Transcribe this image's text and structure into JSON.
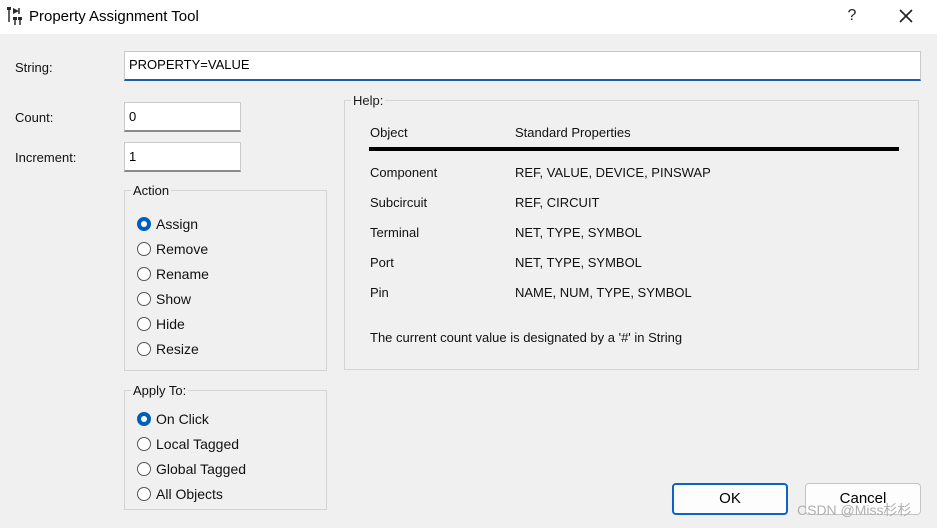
{
  "window": {
    "title": "Property Assignment Tool",
    "help_glyph": "?"
  },
  "fields": {
    "string_label": "String:",
    "string_value": "PROPERTY=VALUE",
    "count_label": "Count:",
    "count_value": "0",
    "increment_label": "Increment:",
    "increment_value": "1"
  },
  "action": {
    "title": "Action",
    "options": [
      "Assign",
      "Remove",
      "Rename",
      "Show",
      "Hide",
      "Resize"
    ],
    "selected": "Assign"
  },
  "apply_to": {
    "title": "Apply To:",
    "options": [
      "On Click",
      "Local Tagged",
      "Global Tagged",
      "All Objects"
    ],
    "selected": "On Click"
  },
  "help": {
    "title": "Help:",
    "headers": [
      "Object",
      "Standard Properties"
    ],
    "rows": [
      [
        "Component",
        "REF, VALUE, DEVICE, PINSWAP"
      ],
      [
        "Subcircuit",
        "REF, CIRCUIT"
      ],
      [
        "Terminal",
        "NET, TYPE, SYMBOL"
      ],
      [
        "Port",
        "NET, TYPE, SYMBOL"
      ],
      [
        "Pin",
        "NAME, NUM, TYPE, SYMBOL"
      ]
    ],
    "note": "The current count value is designated by a '#' in String"
  },
  "buttons": {
    "ok": "OK",
    "cancel": "Cancel"
  },
  "watermark": "CSDN @Miss杉杉",
  "colors": {
    "accent": "#005fb8",
    "default_button_border": "#0a64c8"
  }
}
